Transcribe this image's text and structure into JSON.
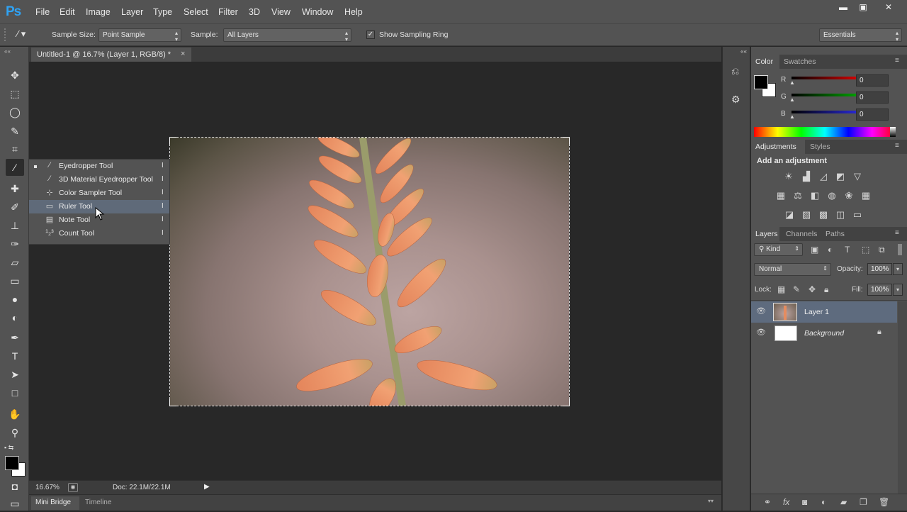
{
  "app": {
    "logo": "Ps"
  },
  "menu": [
    "File",
    "Edit",
    "Image",
    "Layer",
    "Type",
    "Select",
    "Filter",
    "3D",
    "View",
    "Window",
    "Help"
  ],
  "window_controls": {
    "minimize": "▬",
    "maximize": "▣",
    "close": "✕"
  },
  "options": {
    "sample_size_label": "Sample Size:",
    "sample_size_value": "Point Sample",
    "sample_label": "Sample:",
    "sample_value": "All Layers",
    "show_ring_label": "Show Sampling Ring",
    "show_ring_checked": "✓",
    "workspace_value": "Essentials"
  },
  "document": {
    "tab_title": "Untitled-1 @ 16.7% (Layer 1, RGB/8) *",
    "tab_close": "×"
  },
  "flyout": {
    "items": [
      {
        "label": "Eyedropper Tool",
        "key": "I",
        "icon": "eyedropper-icon"
      },
      {
        "label": "3D Material Eyedropper Tool",
        "key": "I",
        "icon": "3d-eyedropper-icon"
      },
      {
        "label": "Color Sampler Tool",
        "key": "I",
        "icon": "color-sampler-icon"
      },
      {
        "label": "Ruler Tool",
        "key": "I",
        "icon": "ruler-icon"
      },
      {
        "label": "Note Tool",
        "key": "I",
        "icon": "note-icon"
      },
      {
        "label": "Count Tool",
        "key": "I",
        "icon": "count-icon"
      }
    ],
    "active_index": 0,
    "hover_index": 3
  },
  "status": {
    "zoom": "16.67%",
    "doc": "Doc: 22.1M/22.1M"
  },
  "bottom_tabs": [
    "Mini Bridge",
    "Timeline"
  ],
  "color_panel": {
    "tabs": [
      "Color",
      "Swatches"
    ],
    "r_label": "R",
    "r_value": "0",
    "g_label": "G",
    "g_value": "0",
    "b_label": "B",
    "b_value": "0",
    "foreground": "#000000",
    "background": "#ffffff"
  },
  "adjustments_panel": {
    "tabs": [
      "Adjustments",
      "Styles"
    ],
    "heading": "Add an adjustment"
  },
  "layers_panel": {
    "tabs": [
      "Layers",
      "Channels",
      "Paths"
    ],
    "kind_label": "Kind",
    "blend_mode": "Normal",
    "opacity_label": "Opacity:",
    "opacity_value": "100%",
    "lock_label": "Lock:",
    "fill_label": "Fill:",
    "fill_value": "100%",
    "layers": [
      {
        "name": "Layer 1",
        "selected": true
      },
      {
        "name": "Background",
        "selected": false
      }
    ]
  }
}
